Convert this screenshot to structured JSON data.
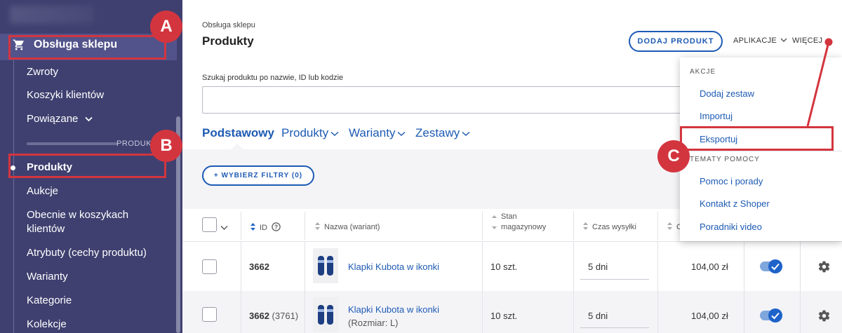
{
  "sidebar": {
    "main": "Obsługa sklepu",
    "section_label": "PRODUKT",
    "items": [
      "Zwroty",
      "Koszyki klientów",
      "Powiązane",
      "Produkty",
      "Aukcje",
      "Obecnie w koszykach klientów",
      "Atrybuty (cechy produktu)",
      "Warianty",
      "Kategorie",
      "Kolekcje"
    ]
  },
  "callouts": {
    "a": "A",
    "b": "B",
    "c": "C"
  },
  "header": {
    "breadcrumb": "Obsługa sklepu",
    "title": "Produkty",
    "add_button": "DODAJ PRODUKT",
    "apps_link": "APLIKACJE",
    "more_link": "WIĘCEJ"
  },
  "search": {
    "label": "Szukaj produktu po nazwie, ID lub kodzie",
    "value": "",
    "placeholder": ""
  },
  "tabs": [
    "Podstawowy",
    "Produkty",
    "Warianty",
    "Zestawy"
  ],
  "filter_button": "+ WYBIERZ FILTRY (0)",
  "table": {
    "headers": {
      "id": "ID",
      "name": "Nazwa (wariant)",
      "stock_1": "Stan",
      "stock_2": "magazynowy",
      "time": "Czas wysyłki",
      "price": "C"
    },
    "rows": [
      {
        "id": "3662",
        "id_sub": "",
        "name": "Klapki Kubota w ikonki",
        "variant": "",
        "stock": "10 szt.",
        "time": "5 dni",
        "price": "104,00 zł",
        "active": true
      },
      {
        "id": "3662",
        "id_sub": "(3761)",
        "name": "Klapki Kubota w ikonki",
        "variant": "(Rozmiar: L)",
        "stock": "10 szt.",
        "time": "5 dni",
        "price": "104,00 zł",
        "active": true
      }
    ]
  },
  "dropdown": {
    "section1": "AKCJE",
    "actions": [
      "Dodaj zestaw",
      "Importuj",
      "Eksportuj"
    ],
    "section2": "TEMATY POMOCY",
    "help": [
      "Pomoc i porady",
      "Kontakt z Shoper",
      "Poradniki video"
    ]
  },
  "colors": {
    "sidebar": "#3f4070",
    "accent": "#1e5bb4",
    "callout": "#d3353f"
  }
}
